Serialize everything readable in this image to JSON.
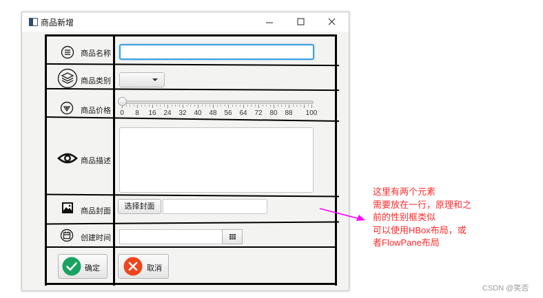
{
  "window": {
    "title": "商品新增",
    "controls": {
      "minimize": "minimize",
      "maximize": "maximize",
      "close": "close"
    }
  },
  "form": {
    "name_label": "商品名称",
    "name_value": "",
    "category_label": "商品类别",
    "category_selected": "",
    "price_label": "商品价格",
    "price_slider": {
      "min": 0,
      "max": 100,
      "value": 0,
      "ticks": [
        "0",
        "8",
        "16",
        "24",
        "32",
        "40",
        "48",
        "56",
        "64",
        "72",
        "80",
        "88",
        "100"
      ]
    },
    "desc_label": "商品描述",
    "desc_value": "",
    "cover_label": "商品封面",
    "cover_button": "选择封面",
    "cover_path": "",
    "date_label": "创建时间",
    "date_value": "",
    "ok_label": "确定",
    "cancel_label": "取消"
  },
  "icons": {
    "name": "list-circle-icon",
    "category": "layers-circle-icon",
    "price": "price-tag-icon",
    "desc": "eye-icon",
    "cover": "image-icon",
    "date": "calendar-icon",
    "ok": "check-circle-icon",
    "cancel": "close-circle-icon"
  },
  "colors": {
    "focus_border": "#3b9ce0",
    "ok_green": "#1aa260",
    "cancel_red": "#f0441c",
    "annotation_red": "#ff2a2a",
    "arrow_magenta": "#ff00ff"
  },
  "annotation": {
    "lines": [
      "这里有两个元素",
      "需要放在一行，原理和之",
      "前的性别框类似",
      "可以使用HBox布局，或",
      "者FlowPane布局"
    ]
  },
  "watermark": "CSDN @笑否"
}
